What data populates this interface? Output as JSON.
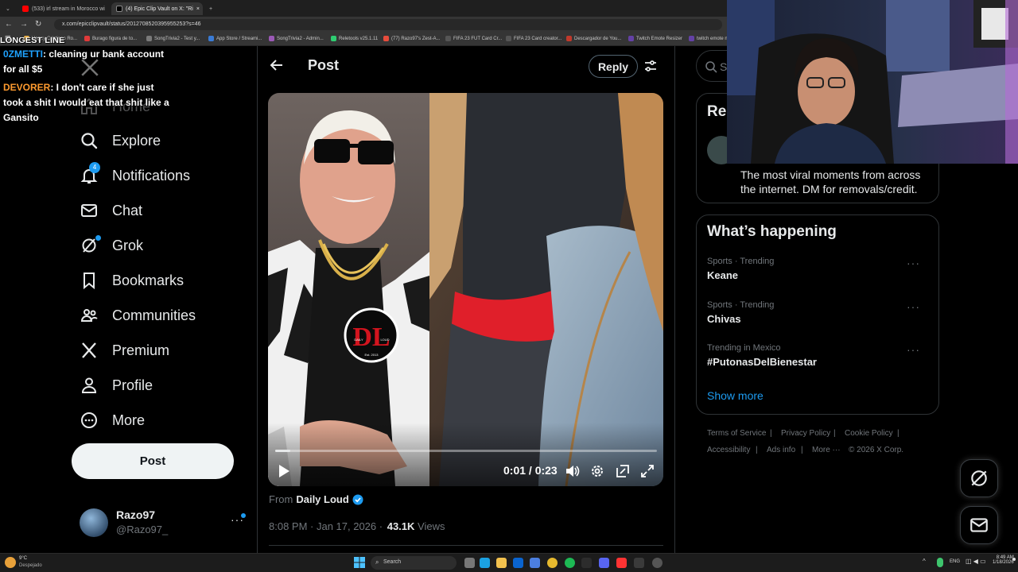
{
  "browser": {
    "tabs": [
      {
        "label": "(533) irl stream in Morocco wi"
      },
      {
        "label": "(4) Epic Clip Vault on X: \"Ri"
      }
    ],
    "url": "x.com/epicclipvault/status/2012708520395955253?s=46",
    "bookmarks": [
      "Happy Cristiano Ro...",
      "Burago figura de to...",
      "SongTrivia2 - Test y...",
      "App Store / Streami...",
      "SongTrivia2 - Admin...",
      "Reletools v25.1.11",
      "(77) Razo97's Zest-A...",
      "FIFA 23 FUT Card Cr...",
      "FIFA 23 Card creator...",
      "Descargador de You...",
      "Twitch Emote Resizer",
      "twitch emote n"
    ]
  },
  "chat": {
    "header": "LONGEST LINE",
    "messages": [
      {
        "user": "0ZMETTI",
        "text": ": cleaning ur bank account for all $5"
      },
      {
        "user": "DEVORER",
        "text": ": I don't care if she just took a shit I would eat that shit like a Gansito"
      }
    ]
  },
  "nav": {
    "home": "Home",
    "explore": "Explore",
    "notifications": "Notifications",
    "notifications_badge": "4",
    "chat": "Chat",
    "grok": "Grok",
    "bookmarks": "Bookmarks",
    "communities": "Communities",
    "premium": "Premium",
    "profile": "Profile",
    "more": "More",
    "post_button": "Post"
  },
  "account": {
    "name": "Razo97",
    "handle": "@Razo97_"
  },
  "post": {
    "header_title": "Post",
    "reply_button": "Reply",
    "video_time": "0:01 / 0:23",
    "video_progress": 0.04,
    "logo_text": "DL",
    "logo_sub1": "DAILY",
    "logo_sub2": "LOUD",
    "logo_est": "Est. 2013",
    "from_label": "From",
    "source_name": "Daily Loud",
    "timestamp": "8:08 PM · Jan 17, 2026 ·",
    "views_count": "43.1K",
    "views_label": "Views"
  },
  "sidebar": {
    "search_placeholder": "Search",
    "relevant_title_partial": "Rel",
    "bio": "The most viral moments from across the internet. DM for removals/credit.",
    "whats_happening_title": "What’s happening",
    "trends": [
      {
        "meta": "Sports · Trending",
        "name": "Keane"
      },
      {
        "meta": "Sports · Trending",
        "name": "Chivas"
      },
      {
        "meta": "Trending in Mexico",
        "name": "#PutonasDelBienestar"
      }
    ],
    "show_more": "Show more",
    "footer": [
      "Terms of Service",
      "|",
      "Privacy Policy",
      "|",
      "Cookie Policy",
      "|",
      "Accessibility",
      "|",
      "Ads info",
      "|",
      "More ···",
      "© 2026 X Corp."
    ]
  },
  "taskbar": {
    "weather_temp": "9°C",
    "weather_desc": "Despejado",
    "search_label": "Search",
    "lang": "ENG",
    "time": "8:49 AM",
    "date": "1/18/2026"
  },
  "colors": {
    "accent": "#1d9bf0",
    "text_primary": "#e7e9ea",
    "text_secondary": "#71767b",
    "border": "#2f3336",
    "logo_red": "#d2141e"
  }
}
